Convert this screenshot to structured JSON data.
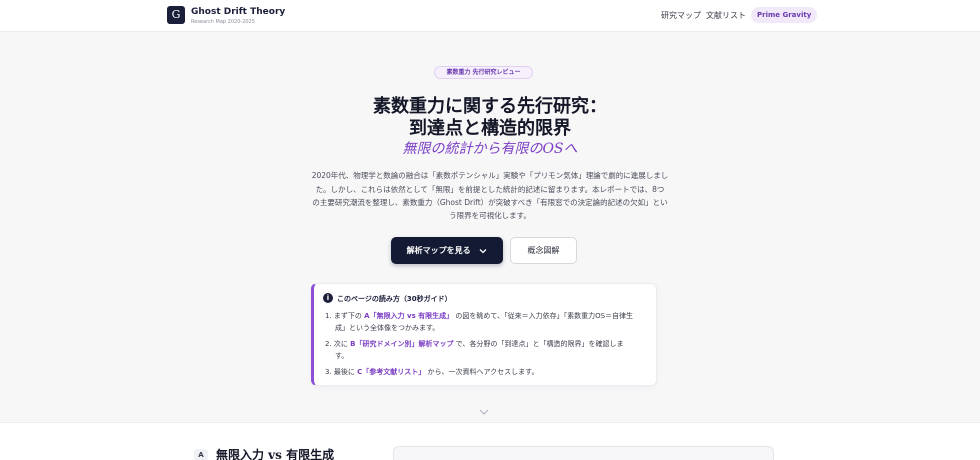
{
  "header": {
    "logo_letter": "G",
    "brand_name": "Ghost Drift Theory",
    "brand_sub": "Research Map 2020-2025",
    "nav": [
      "研究マップ",
      "文献リスト"
    ],
    "nav_pill": "Prime Gravity"
  },
  "hero": {
    "tag": "素数重力 先行研究レビュー",
    "title_line1": "素数重力に関する先行研究：",
    "title_line2": "到達点と構造的限界",
    "subtitle": "無限の統計から有限のOSへ",
    "lead": [
      "2020年代、物理学と数論の融合は「素数ポテンシャル」実験や「プリモン気体」理論で劇的に進展しまし",
      "た。しかし、これらは依然として「無限」を前提とした統計的記述に留まります。本レポートでは、8つ",
      "の主要研究潮流を整理し、素数重力（Ghost Drift）が突破すべき「有限窓での決定論的記述の欠如」とい",
      "う限界を可視化します。"
    ],
    "primary_button": "解析マップを見る",
    "secondary_button": "概念図解"
  },
  "guide": {
    "icon": "i",
    "title": "このページの読み方（30秒ガイド）",
    "items": [
      {
        "num": "1.",
        "pre": "まず下の",
        "hl": "A「無限入力 vs 有限生成」",
        "post": "の図を眺めて、「従来＝入力依存」「素数重力OS＝自律生",
        "cont": "成」という全体像をつかみます。"
      },
      {
        "num": "2.",
        "pre": "次に",
        "hl": "B「研究ドメイン別」解析マップ",
        "post": "で、各分野の「到達点」と「構造的限界」を確認しま",
        "cont": "す。"
      },
      {
        "num": "3.",
        "pre": "最後に",
        "hl": "C「参考文献リスト」",
        "post": "から、一次資料へアクセスします。",
        "cont": ""
      }
    ]
  },
  "section": {
    "letter": "A",
    "title": "無限入力 vs 有限生成"
  }
}
